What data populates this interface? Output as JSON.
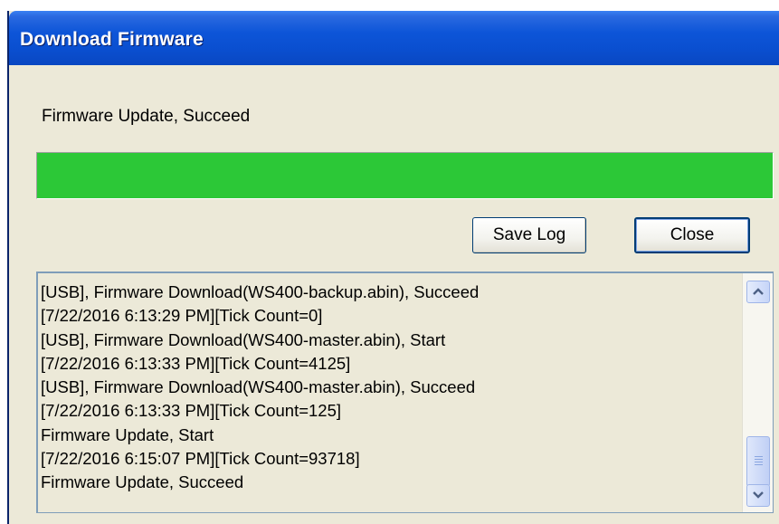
{
  "window": {
    "title": "Download Firmware"
  },
  "status": {
    "text": "Firmware Update, Succeed"
  },
  "progress": {
    "percent": 100,
    "color": "#2cc837"
  },
  "buttons": {
    "save_log": "Save Log",
    "close": "Close"
  },
  "log": {
    "lines": [
      "[USB], Firmware Download(WS400-backup.abin), Succeed",
      "[7/22/2016 6:13:29 PM][Tick Count=0]",
      "[USB], Firmware Download(WS400-master.abin), Start",
      "[7/22/2016 6:13:33 PM][Tick Count=4125]",
      "[USB], Firmware Download(WS400-master.abin), Succeed",
      "[7/22/2016 6:13:33 PM][Tick Count=125]",
      "Firmware Update, Start",
      "[7/22/2016 6:15:07 PM][Tick Count=93718]",
      "Firmware Update, Succeed"
    ],
    "scrollbar": {
      "up_icon": "chevron-up-icon",
      "down_icon": "chevron-down-icon"
    }
  },
  "colors": {
    "titlebar": "#0a4fd0",
    "dialog_bg": "#ece9d8",
    "progress_fill": "#2cc837"
  }
}
